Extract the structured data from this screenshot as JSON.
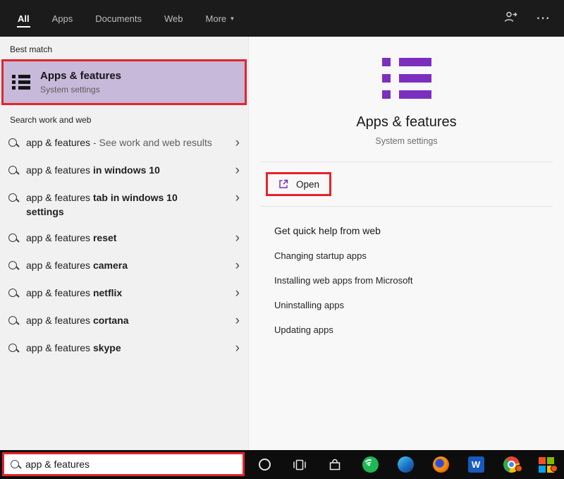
{
  "colors": {
    "accent": "#7b2fbf",
    "annotation": "#e5232b"
  },
  "topbar": {
    "tabs": [
      {
        "label": "All",
        "active": true
      },
      {
        "label": "Apps",
        "active": false
      },
      {
        "label": "Documents",
        "active": false
      },
      {
        "label": "Web",
        "active": false
      },
      {
        "label": "More",
        "active": false
      }
    ],
    "more_caret": "▾",
    "ellipsis_glyph": "⋯"
  },
  "left": {
    "best_match_header": "Best match",
    "best_match": {
      "title": "Apps & features",
      "subtitle": "System settings"
    },
    "section_header": "Search work and web",
    "chevron_glyph": "›",
    "suggestions": [
      {
        "plain": "app & features",
        "bold": "",
        "gray": " - See work and web results"
      },
      {
        "plain": "app & features ",
        "bold": "in windows 10",
        "gray": ""
      },
      {
        "plain": "app & features ",
        "bold": "tab in windows 10 settings",
        "gray": ""
      },
      {
        "plain": "app & features ",
        "bold": "reset",
        "gray": ""
      },
      {
        "plain": "app & features ",
        "bold": "camera",
        "gray": ""
      },
      {
        "plain": "app & features ",
        "bold": "netflix",
        "gray": ""
      },
      {
        "plain": "app & features ",
        "bold": "cortana",
        "gray": ""
      },
      {
        "plain": "app & features ",
        "bold": "skype",
        "gray": ""
      }
    ],
    "search_value": "app & features"
  },
  "right": {
    "title": "Apps & features",
    "subtitle": "System settings",
    "open_label": "Open",
    "help_header": "Get quick help from web",
    "help_links": [
      "Changing startup apps",
      "Installing web apps from Microsoft",
      "Uninstalling apps",
      "Updating apps"
    ]
  },
  "taskbar": {
    "word_app_letter": "W"
  }
}
